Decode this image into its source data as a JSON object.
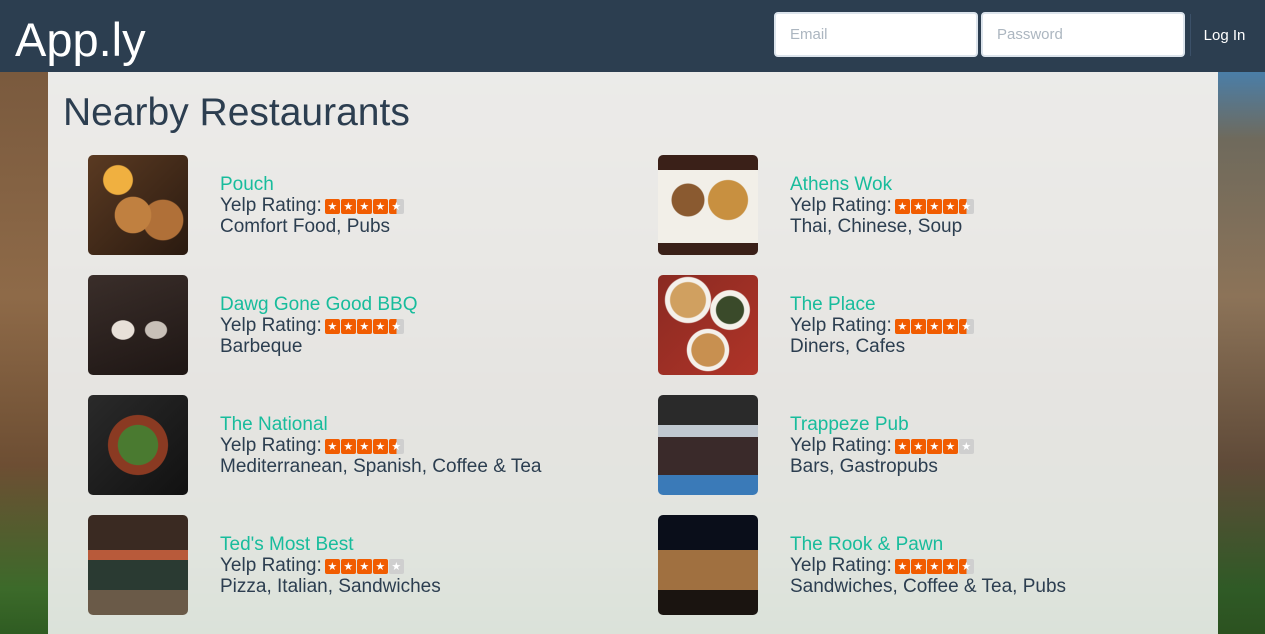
{
  "header": {
    "brand": "App.ly",
    "email_placeholder": "Email",
    "password_placeholder": "Password",
    "login_label": "Log In"
  },
  "main": {
    "title": "Nearby Restaurants",
    "rating_label": "Yelp Rating:",
    "restaurants": [
      {
        "name": "Pouch",
        "rating": 4.5,
        "categories": "Comfort Food, Pubs"
      },
      {
        "name": "Athens Wok",
        "rating": 4.5,
        "categories": "Thai, Chinese, Soup"
      },
      {
        "name": "Dawg Gone Good BBQ",
        "rating": 4.5,
        "categories": "Barbeque"
      },
      {
        "name": "The Place",
        "rating": 4.5,
        "categories": "Diners, Cafes"
      },
      {
        "name": "The National",
        "rating": 4.5,
        "categories": "Mediterranean, Spanish, Coffee & Tea"
      },
      {
        "name": "Trappeze Pub",
        "rating": 4,
        "categories": "Bars, Gastropubs"
      },
      {
        "name": "Ted's Most Best",
        "rating": 4,
        "categories": "Pizza, Italian, Sandwiches"
      },
      {
        "name": "The Rook & Pawn",
        "rating": 4.5,
        "categories": "Sandwiches, Coffee & Tea, Pubs"
      }
    ]
  },
  "colors": {
    "navbar": "#2c3e50",
    "accent": "#18bc9c",
    "text": "#2c3e50",
    "star": "#f15c00"
  }
}
